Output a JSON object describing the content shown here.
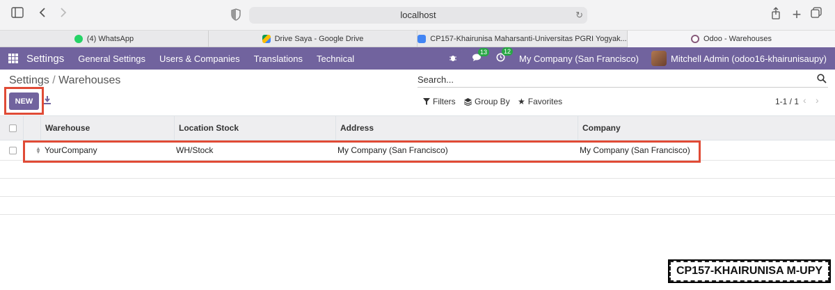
{
  "browser": {
    "address": "localhost",
    "tabs": [
      {
        "label": "(4) WhatsApp",
        "color": "#25d366"
      },
      {
        "label": "Drive Saya - Google Drive",
        "color": "#fbbc04"
      },
      {
        "label": "CP157-Khairunisa Maharsanti-Universitas PGRI Yogyak...",
        "color": "#4285f4"
      },
      {
        "label": "Odoo - Warehouses",
        "color": "#875a7b"
      }
    ]
  },
  "navbar": {
    "brand": "Settings",
    "menu": [
      "General Settings",
      "Users & Companies",
      "Translations",
      "Technical"
    ],
    "messages_count": "13",
    "activities_count": "12",
    "company": "My Company (San Francisco)",
    "user": "Mitchell Admin (odoo16-khairunisaupy)"
  },
  "control_panel": {
    "breadcrumb_root": "Settings",
    "breadcrumb_sep": "/",
    "breadcrumb_current": "Warehouses",
    "new_label": "NEW",
    "search_placeholder": "Search...",
    "filters_label": "Filters",
    "groupby_label": "Group By",
    "favorites_label": "Favorites",
    "pager": "1-1 / 1"
  },
  "table": {
    "columns": [
      "Warehouse",
      "Location Stock",
      "Address",
      "Company"
    ],
    "rows": [
      {
        "warehouse": "YourCompany",
        "location_stock": "WH/Stock",
        "address": "My Company (San Francisco)",
        "company": "My Company (San Francisco)"
      }
    ]
  },
  "watermark": "CP157-KHAIRUNISA M-UPY",
  "colors": {
    "brand": "#71639e",
    "highlight": "#e04b36",
    "badge": "#28a745"
  }
}
